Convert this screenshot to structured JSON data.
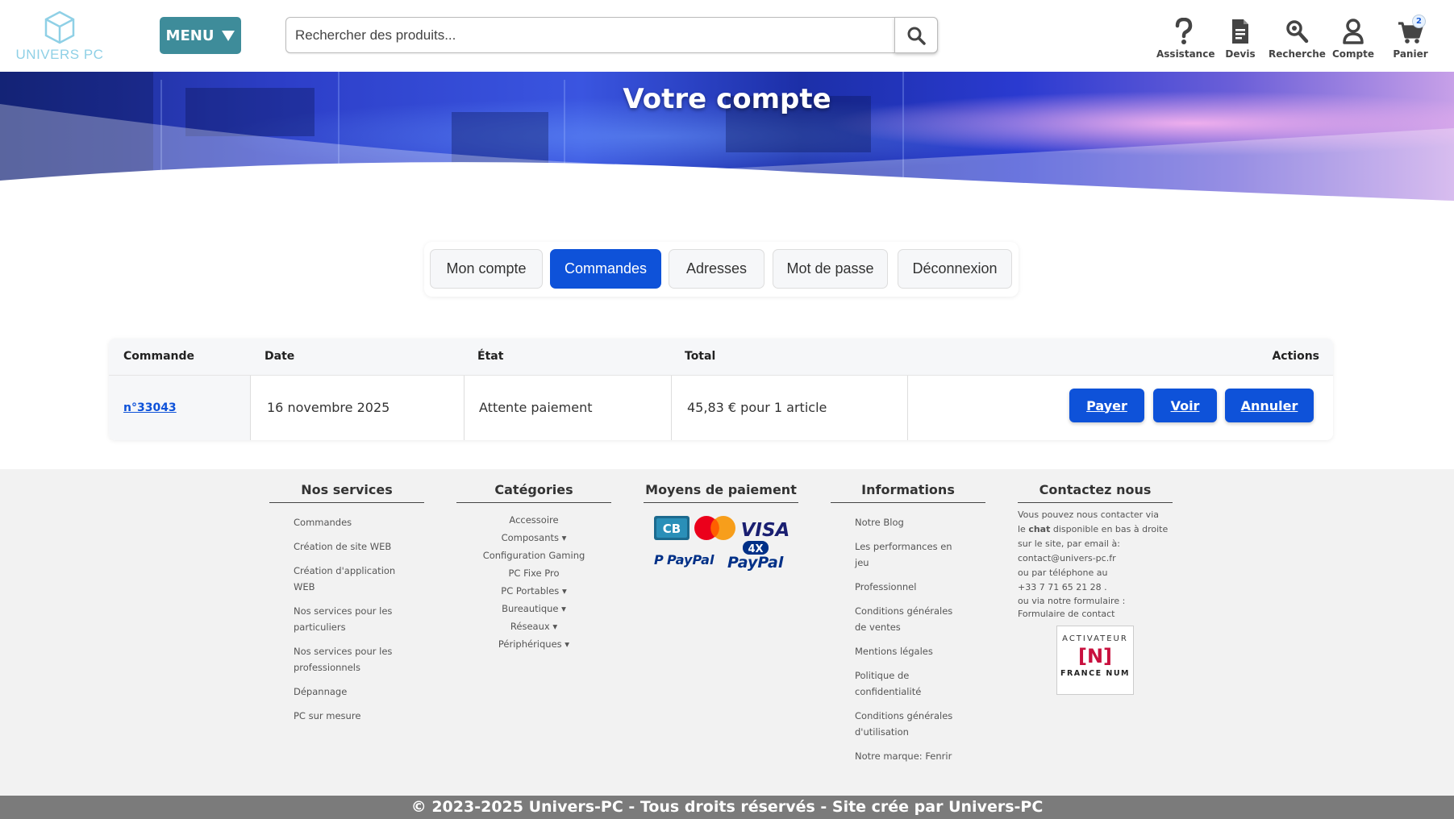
{
  "header": {
    "logo_text": "UNIVERS PC",
    "menu_label": "MENU",
    "search_placeholder": "Rechercher des produits...",
    "nav": {
      "assistance": "Assistance",
      "devis": "Devis",
      "recherche": "Recherche",
      "compte": "Compte",
      "panier": "Panier",
      "cart_count": "2"
    }
  },
  "banner": {
    "title": "Votre compte"
  },
  "tabs": [
    {
      "label": "Mon compte"
    },
    {
      "label": "Commandes"
    },
    {
      "label": "Adresses"
    },
    {
      "label": "Mot de passe"
    },
    {
      "label": "Déconnexion"
    }
  ],
  "orders": {
    "headers": {
      "commande": "Commande",
      "date": "Date",
      "etat": "État",
      "total": "Total",
      "actions": "Actions"
    },
    "rows": [
      {
        "commande": "n°33043",
        "date": "16 novembre 2025",
        "etat": "Attente paiement",
        "total": "45,83 € pour 1 article",
        "actions": {
          "payer": "Payer",
          "voir": "Voir",
          "annuler": "Annuler"
        }
      }
    ]
  },
  "footer": {
    "services": {
      "title": "Nos services",
      "items": [
        "Commandes",
        "Création de site WEB",
        "Création d'application",
        "WEB",
        "Nos services pour les",
        "particuliers",
        "Nos services pour les",
        "professionnels",
        "Dépannage",
        "PC sur mesure"
      ]
    },
    "categories": {
      "title": "Catégories",
      "items": [
        "Accessoire",
        "Composants ▾",
        "Configuration Gaming",
        "PC Fixe Pro",
        "PC Portables ▾",
        "Bureautique ▾",
        "Réseaux ▾",
        "Périphériques ▾"
      ]
    },
    "payment": {
      "title": "Moyens de paiement",
      "cb": "CB",
      "visa": "VISA",
      "paypal": "PayPal",
      "paypal4x_badge": "4X",
      "paypal4x": "PayPal"
    },
    "informations": {
      "title": "Informations",
      "items": [
        "Notre Blog",
        "Les performances en",
        "jeu",
        "Professionnel",
        "Conditions générales",
        "de ventes",
        "Mentions légales",
        "Politique de",
        "confidentialité",
        "Conditions générales",
        "d'utilisation",
        "Notre marque: Fenrir"
      ]
    },
    "contact": {
      "title": "Contactez nous",
      "line1": "Vous pouvez nous contacter via",
      "line2_pre": "le ",
      "line2_bold": "chat",
      "line2_post": " disponible en bas à droite",
      "line3": "sur le site, par email à:",
      "email": "contact@univers-pc.fr",
      "line5": "ou par téléphone au",
      "phone": "+33 7 71 65 21 28 .",
      "line7": "ou via notre formulaire :",
      "form_link": "Formulaire de contact"
    },
    "francenum": {
      "top": "ACTIVATEUR",
      "logo": "[N]",
      "bottom": "FRANCE NUM"
    },
    "copyright": "© 2023-2025 Univers-PC - Tous droits réservés - Site crée par Univers-PC"
  },
  "colors": {
    "primary": "#0e52d9",
    "menu_teal": "#3e8c9a",
    "logo_blue": "#8fd0e6",
    "footer_bg": "#f2f2f2",
    "copyright_bg": "#7b7b7b"
  }
}
